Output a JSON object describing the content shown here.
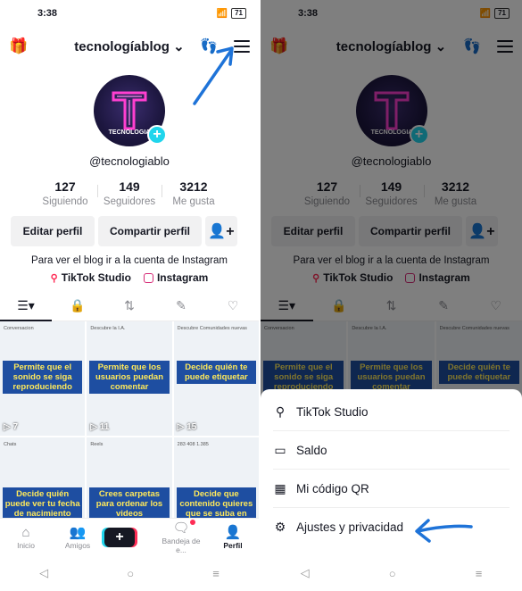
{
  "status_bar": {
    "time": "3:38",
    "battery": "71"
  },
  "profile": {
    "username": "tecnologíablog",
    "handle": "@tecnologiablo",
    "avatar_text": "TECNOLOGIA",
    "stats": [
      {
        "value": "127",
        "label": "Siguiendo"
      },
      {
        "value": "149",
        "label": "Seguidores"
      },
      {
        "value": "3212",
        "label": "Me gusta"
      }
    ],
    "edit_label": "Editar perfil",
    "share_label": "Compartir perfil",
    "bio": "Para ver el blog ir a la cuenta de Instagram",
    "links": [
      {
        "label": "TikTok Studio"
      },
      {
        "label": "Instagram"
      }
    ]
  },
  "tabs": [
    "videos",
    "privados",
    "reposts",
    "etiquetados",
    "me-gusta"
  ],
  "videos": [
    {
      "caption": "Permite que el sonido se siga reproduciendo",
      "views": "▷ 7",
      "header": "Conversacion"
    },
    {
      "caption": "Permite que los usuarios puedan comentar",
      "views": "▷ 11",
      "header": "Descubre la I.A."
    },
    {
      "caption": "Decide quién te puede etiquetar",
      "views": "▷ 15",
      "header": "Descubre Comunidades nuevas"
    },
    {
      "caption": "Decide quién puede ver tu fecha de nacimiento",
      "views": "",
      "header": "Chats"
    },
    {
      "caption": "Crees carpetas para ordenar los videos",
      "views": "",
      "header": "Reels"
    },
    {
      "caption": "Decide que contenido quieres que se suba en otras redes sociales",
      "views": "",
      "header": "283 408 1.385"
    }
  ],
  "bottom_nav": [
    {
      "label": "Inicio"
    },
    {
      "label": "Amigos"
    },
    {
      "label": "+"
    },
    {
      "label": "Bandeja de e..."
    },
    {
      "label": "Perfil"
    }
  ],
  "menu": {
    "items": [
      {
        "label": "TikTok Studio",
        "icon": "person-star-icon"
      },
      {
        "label": "Saldo",
        "icon": "wallet-icon"
      },
      {
        "label": "Mi código QR",
        "icon": "qr-icon"
      },
      {
        "label": "Ajustes y privacidad",
        "icon": "gear-icon"
      }
    ]
  },
  "colors": {
    "accent": "#20d5ec",
    "primary": "#fe2c55",
    "arrow": "#1e73d8",
    "caption_bg": "#1e4ea1",
    "caption_text": "#ffe95a"
  }
}
